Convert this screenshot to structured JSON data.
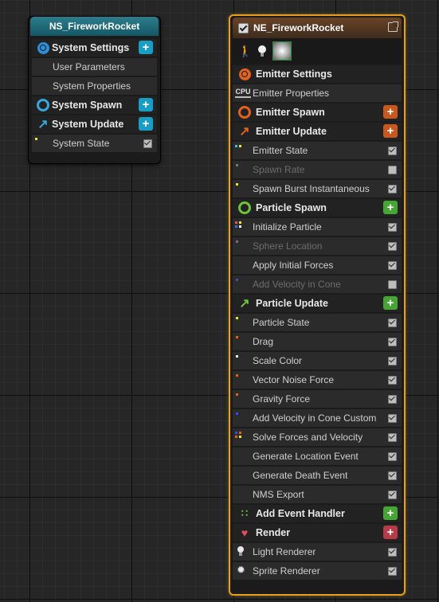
{
  "system_node": {
    "title": "NS_FireworkRocket",
    "rows": [
      {
        "label": "System Settings",
        "kind": "section",
        "icon": "settings-icon",
        "plus": "teal"
      },
      {
        "label": "User Parameters",
        "kind": "item"
      },
      {
        "label": "System Properties",
        "kind": "item"
      },
      {
        "label": "System Spawn",
        "kind": "section",
        "icon": "spawn-icon",
        "plus": "teal"
      },
      {
        "label": "System Update",
        "kind": "section",
        "icon": "update-icon",
        "plus": "teal"
      },
      {
        "label": "System State",
        "kind": "item",
        "checked": true,
        "dot": "#e8e23a"
      }
    ]
  },
  "emitter_node": {
    "title": "NE_FireworkRocket",
    "rows": [
      {
        "label": "Emitter Settings",
        "kind": "section"
      },
      {
        "label": "Emitter Properties",
        "kind": "plain"
      },
      {
        "label": "Emitter Spawn",
        "kind": "section"
      },
      {
        "label": "Emitter Update",
        "kind": "section"
      },
      {
        "label": "Emitter State",
        "kind": "item",
        "checked": true
      },
      {
        "label": "Spawn Rate",
        "kind": "item",
        "checked": false
      },
      {
        "label": "Spawn Burst Instantaneous",
        "kind": "item",
        "checked": true
      },
      {
        "label": "Particle Spawn",
        "kind": "section"
      },
      {
        "label": "Initialize Particle",
        "kind": "item",
        "checked": true
      },
      {
        "label": "Sphere Location",
        "kind": "item",
        "checked": true
      },
      {
        "label": "Apply Initial Forces",
        "kind": "item",
        "checked": true
      },
      {
        "label": "Add Velocity in Cone",
        "kind": "item",
        "checked": false
      },
      {
        "label": "Particle Update",
        "kind": "section"
      },
      {
        "label": "Particle State",
        "kind": "item",
        "checked": true
      },
      {
        "label": "Drag",
        "kind": "item",
        "checked": true
      },
      {
        "label": "Scale Color",
        "kind": "item",
        "checked": true
      },
      {
        "label": "Vector Noise Force",
        "kind": "item",
        "checked": true
      },
      {
        "label": "Gravity Force",
        "kind": "item",
        "checked": true
      },
      {
        "label": "Add Velocity in Cone Custom",
        "kind": "item",
        "checked": true
      },
      {
        "label": "Solve Forces and Velocity",
        "kind": "item",
        "checked": true
      },
      {
        "label": "Generate Location Event",
        "kind": "item",
        "checked": true
      },
      {
        "label": "Generate Death Event",
        "kind": "item",
        "checked": true
      },
      {
        "label": "NMS Export",
        "kind": "item",
        "checked": true
      },
      {
        "label": "Add Event Handler",
        "kind": "section"
      },
      {
        "label": "Render",
        "kind": "section"
      },
      {
        "label": "Light Renderer",
        "kind": "item",
        "checked": true
      },
      {
        "label": "Sprite Renderer",
        "kind": "item",
        "checked": true
      }
    ]
  },
  "colors": {
    "selection_outline": "#e89f1c",
    "system_title": "#1f6b7a",
    "emitter_title": "#5a3a24",
    "teal_button": "#1a9dc4",
    "orange_button": "#c8581e",
    "green_button": "#46a534",
    "red_button": "#b83b48"
  }
}
